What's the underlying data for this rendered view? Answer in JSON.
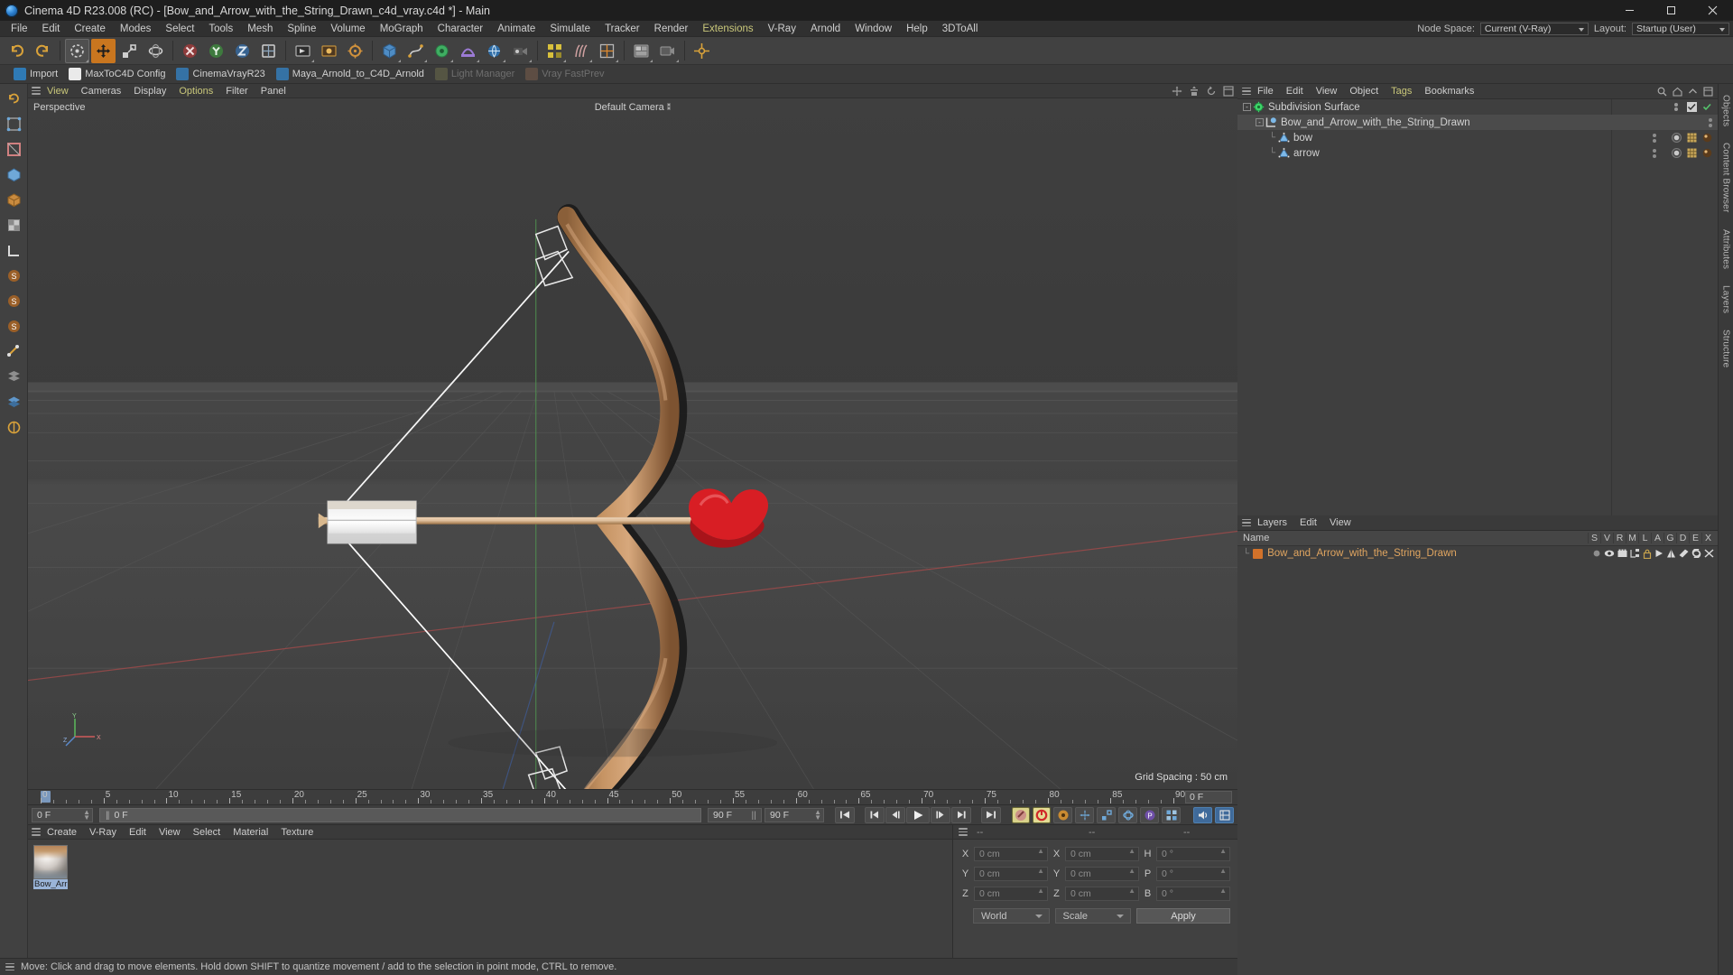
{
  "window": {
    "title": "Cinema 4D R23.008 (RC) - [Bow_and_Arrow_with_the_String_Drawn_c4d_vray.c4d *] - Main",
    "minimize_label": "–",
    "maximize_label": "❐",
    "close_label": "✕"
  },
  "menubar": {
    "items": [
      {
        "label": "File",
        "accent": false
      },
      {
        "label": "Edit",
        "accent": false
      },
      {
        "label": "Create",
        "accent": false
      },
      {
        "label": "Modes",
        "accent": false
      },
      {
        "label": "Select",
        "accent": false
      },
      {
        "label": "Tools",
        "accent": false
      },
      {
        "label": "Mesh",
        "accent": false
      },
      {
        "label": "Spline",
        "accent": false
      },
      {
        "label": "Volume",
        "accent": false
      },
      {
        "label": "MoGraph",
        "accent": false
      },
      {
        "label": "Character",
        "accent": false
      },
      {
        "label": "Animate",
        "accent": false
      },
      {
        "label": "Simulate",
        "accent": false
      },
      {
        "label": "Tracker",
        "accent": false
      },
      {
        "label": "Render",
        "accent": false
      },
      {
        "label": "Extensions",
        "accent": true
      },
      {
        "label": "V-Ray",
        "accent": false
      },
      {
        "label": "Arnold",
        "accent": false
      },
      {
        "label": "Window",
        "accent": false
      },
      {
        "label": "Help",
        "accent": false
      },
      {
        "label": "3DToAll",
        "accent": false
      }
    ],
    "node_space_label": "Node Space:",
    "node_space_value": "Current (V-Ray)",
    "layout_label": "Layout:",
    "layout_value": "Startup (User)"
  },
  "pluginbar": {
    "items": [
      {
        "label": "Import",
        "dim": false,
        "color": "#2f7ab5"
      },
      {
        "label": "MaxToC4D Config",
        "dim": false,
        "color": "#eaeaea"
      },
      {
        "label": "CinemaVrayR23",
        "dim": false,
        "color": "#3572a5"
      },
      {
        "label": "Maya_Arnold_to_C4D_Arnold",
        "dim": false,
        "color": "#3572a5"
      },
      {
        "label": "Light Manager",
        "dim": true,
        "color": "#6b6b4a"
      },
      {
        "label": "Vray FastPrev",
        "dim": true,
        "color": "#7a5d4a"
      }
    ]
  },
  "viewport": {
    "menu_items": [
      "View",
      "Cameras",
      "Display",
      "Options",
      "Filter",
      "Panel"
    ],
    "perspective_label": "Perspective",
    "camera_label": "Default Camera",
    "grid_spacing": "Grid Spacing : 50 cm",
    "axis_x": "X",
    "axis_y": "Y",
    "axis_z": "Z"
  },
  "timeline": {
    "ticks": [
      0,
      5,
      10,
      15,
      20,
      25,
      30,
      35,
      40,
      45,
      50,
      55,
      60,
      65,
      70,
      75,
      80,
      85,
      90
    ],
    "current_frame": "0 F",
    "end_field": "0 F",
    "preview_start": "0 F",
    "preview_end_a": "90 F",
    "preview_end_b": "90 F",
    "scrub_value": "0 F",
    "frame_right": "0 F"
  },
  "transport": {
    "buttons": [
      {
        "name": "go-to-start",
        "glyph": "⏮"
      },
      {
        "name": "previous-keyframe",
        "glyph": "◀|"
      },
      {
        "name": "step-back",
        "glyph": "◁|"
      },
      {
        "name": "play",
        "glyph": "▶"
      },
      {
        "name": "step-forward",
        "glyph": "|▷"
      },
      {
        "name": "next-keyframe",
        "glyph": "|▶"
      },
      {
        "name": "go-to-end",
        "glyph": "⏭"
      }
    ]
  },
  "material_manager": {
    "menu_items": [
      "Create",
      "V-Ray",
      "Edit",
      "View",
      "Select",
      "Material",
      "Texture"
    ],
    "materials": [
      {
        "name": "Bow_Arr"
      }
    ]
  },
  "coordinates": {
    "header_cells": [
      "--",
      "--",
      "--"
    ],
    "rows": [
      {
        "label": "X",
        "position": "0 cm",
        "label2": "X",
        "size": "0 cm",
        "label3": "H",
        "rotation": "0 °"
      },
      {
        "label": "Y",
        "position": "0 cm",
        "label2": "Y",
        "size": "0 cm",
        "label3": "P",
        "rotation": "0 °"
      },
      {
        "label": "Z",
        "position": "0 cm",
        "label2": "Z",
        "size": "0 cm",
        "label3": "B",
        "rotation": "0 °"
      }
    ],
    "space_select": "World",
    "mode_select": "Scale",
    "apply_label": "Apply"
  },
  "object_manager": {
    "menu_items": [
      "File",
      "Edit",
      "View",
      "Object",
      "Tags",
      "Bookmarks"
    ],
    "rows": [
      {
        "label": "Subdivision Surface",
        "depth": 0,
        "icon": "subdivision-surface-icon",
        "selected": false,
        "expander": "-"
      },
      {
        "label": "Bow_and_Arrow_with_the_String_Drawn",
        "depth": 1,
        "icon": "null-object-icon",
        "selected": true,
        "expander": "-"
      },
      {
        "label": "bow",
        "depth": 2,
        "icon": "polygon-object-icon",
        "selected": false,
        "expander": ""
      },
      {
        "label": "arrow",
        "depth": 2,
        "icon": "polygon-object-icon",
        "selected": false,
        "expander": ""
      }
    ]
  },
  "layer_manager": {
    "menu_items": [
      "Layers",
      "Edit",
      "View"
    ],
    "name_header": "Name",
    "columns": [
      "S",
      "V",
      "R",
      "M",
      "L",
      "A",
      "G",
      "D",
      "E",
      "X"
    ],
    "rows": [
      {
        "name": "Bow_and_Arrow_with_the_String_Drawn",
        "color": "#d2722a"
      }
    ]
  },
  "right_rail": {
    "items": [
      "Objects",
      "Content Browser",
      "Attributes",
      "Layers",
      "Structure"
    ]
  },
  "statusbar": {
    "message": "Move: Click and drag to move elements. Hold down SHIFT to quantize movement / add to the selection in point mode, CTRL to remove."
  }
}
